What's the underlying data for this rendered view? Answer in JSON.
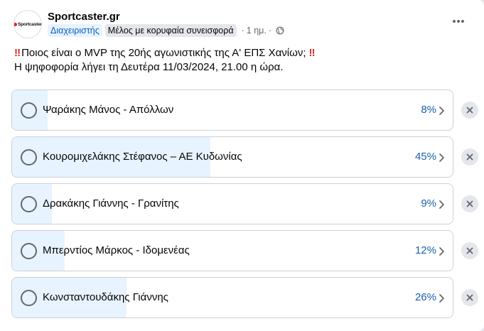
{
  "post": {
    "page_name": "Sportcaster.gr",
    "avatar_logo_text": "Sportcaster",
    "role_badge": "Διαχειριστής",
    "contributor_badge": "Μέλος με κορυφαία συνεισφορά",
    "time": "1 ημ.",
    "line1": "Ποιος είναι ο MVP της 20ής αγωνιστικής της Α' ΕΠΣ Χανίων;",
    "line2": "Η ψηφοφορία λήγει τη Δευτέρα 11/03/2024, 21.00 η ώρα.",
    "emphasis_mark": "‼"
  },
  "poll": {
    "options": [
      {
        "label": "Ψαράκης Μάνος - Απόλλων",
        "percent_text": "8%",
        "share": 8
      },
      {
        "label": "Κουρομιχελάκης Στέφανος – ΑΕ Κυδωνίας",
        "percent_text": "45%",
        "share": 45
      },
      {
        "label": "Δρακάκης Γιάννης - Γρανίτης",
        "percent_text": "9%",
        "share": 9
      },
      {
        "label": "Μπερντίος Μάρκος - Ιδομενέας",
        "percent_text": "12%",
        "share": 12
      },
      {
        "label": "Κωνσταντουδάκης Γιάννης",
        "percent_text": "26%",
        "share": 26
      }
    ]
  },
  "colors": {
    "accent": "#1c5fb1",
    "fill": "#e7f3ff",
    "emphasis": "#e02a2a"
  },
  "icons": [
    "globe-icon",
    "more-icon",
    "radio-icon",
    "chevron-right-icon",
    "close-icon"
  ]
}
